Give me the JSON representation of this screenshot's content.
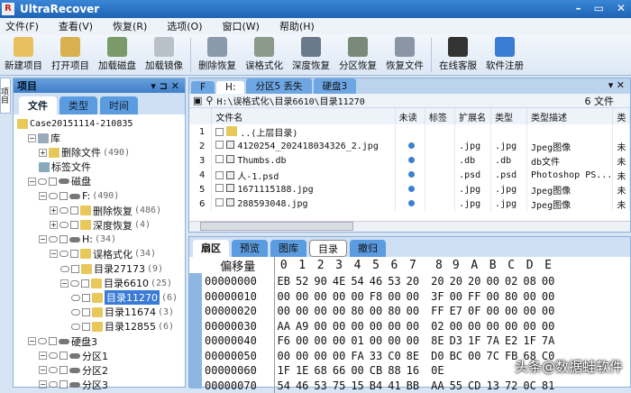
{
  "app": {
    "title": "UltraRecover",
    "logo": "R"
  },
  "menu": [
    "文件(F)",
    "查看(V)",
    "恢复(R)",
    "选项(O)",
    "窗口(W)",
    "帮助(H)"
  ],
  "toolbar": [
    {
      "label": "新建项目",
      "icon": "new-project-icon",
      "color": "#e8c060"
    },
    {
      "label": "打开项目",
      "icon": "open-project-icon",
      "color": "#d8b050"
    },
    {
      "label": "加载磁盘",
      "icon": "load-disk-icon",
      "color": "#7a9a6a"
    },
    {
      "label": "加载镜像",
      "icon": "load-image-icon",
      "color": "#b8c0c8"
    },
    {
      "label": "删除恢复",
      "icon": "delete-recover-icon",
      "color": "#8a9aaa"
    },
    {
      "label": "误格式化",
      "icon": "format-recover-icon",
      "color": "#8a9a8a"
    },
    {
      "label": "深度恢复",
      "icon": "deep-recover-icon",
      "color": "#6a7a8a"
    },
    {
      "label": "分区恢复",
      "icon": "partition-recover-icon",
      "color": "#7a8a7a"
    },
    {
      "label": "恢复文件",
      "icon": "save-file-icon",
      "color": "#8a96a6"
    },
    {
      "label": "在线客服",
      "icon": "qq-penguin-icon",
      "color": "#333333"
    },
    {
      "label": "软件注册",
      "icon": "dollar-icon",
      "color": "#3a7bd5"
    }
  ],
  "sidebar": {
    "tab": "项目"
  },
  "project": {
    "title": "项目",
    "tabs": [
      "文件",
      "类型",
      "时间"
    ],
    "tree": [
      {
        "label": "Case20151114-210835",
        "count": "",
        "level": 0,
        "type": "case"
      },
      {
        "label": "库",
        "count": "",
        "level": 1,
        "type": "lib"
      },
      {
        "label": "删除文件",
        "count": "(490)",
        "level": 2,
        "type": "folder"
      },
      {
        "label": "标签文件",
        "count": "",
        "level": 2,
        "type": "tag"
      },
      {
        "label": "磁盘",
        "count": "",
        "level": 1,
        "type": "disk"
      },
      {
        "label": "F:",
        "count": "(490)",
        "level": 2,
        "type": "disk"
      },
      {
        "label": "删除恢复",
        "count": "(486)",
        "level": 3,
        "type": "folder"
      },
      {
        "label": "深度恢复",
        "count": "(4)",
        "level": 3,
        "type": "folder"
      },
      {
        "label": "H:",
        "count": "(34)",
        "level": 2,
        "type": "disk"
      },
      {
        "label": "误格式化",
        "count": "(34)",
        "level": 3,
        "type": "folder"
      },
      {
        "label": "目录27173",
        "count": "(9)",
        "level": 4,
        "type": "folder"
      },
      {
        "label": "目录6610",
        "count": "(25)",
        "level": 4,
        "type": "folder"
      },
      {
        "label": "目录11270",
        "count": "(6)",
        "level": 5,
        "type": "folder",
        "selected": true
      },
      {
        "label": "目录11674",
        "count": "(3)",
        "level": 5,
        "type": "folder"
      },
      {
        "label": "目录12855",
        "count": "(6)",
        "level": 5,
        "type": "folder"
      },
      {
        "label": "硬盘3",
        "count": "",
        "level": 1,
        "type": "disk"
      },
      {
        "label": "分区1",
        "count": "",
        "level": 2,
        "type": "disk"
      },
      {
        "label": "分区2",
        "count": "",
        "level": 2,
        "type": "disk"
      },
      {
        "label": "分区3",
        "count": "",
        "level": 2,
        "type": "disk"
      }
    ]
  },
  "files": {
    "tabs": [
      "F",
      "H:",
      "分区5 丢失",
      "硬盘3"
    ],
    "path": "H:\\误格式化\\目录6610\\目录11270",
    "count": "6 文件",
    "columns": [
      "文件名",
      "未读",
      "标签",
      "扩展名",
      "类型",
      "类型描述",
      "类"
    ],
    "rows": [
      {
        "n": "1",
        "name": "..(上层目录)",
        "unread": false,
        "ext": "",
        "type": "",
        "desc": "",
        "extra": ""
      },
      {
        "n": "2",
        "name": "4120254_202418034326_2.jpg",
        "unread": true,
        "ext": ".jpg",
        "type": ".jpg",
        "desc": "Jpeg图像",
        "extra": "未"
      },
      {
        "n": "3",
        "name": "Thumbs.db",
        "unread": true,
        "ext": ".db",
        "type": ".db",
        "desc": "db文件",
        "extra": "未"
      },
      {
        "n": "4",
        "name": "人-1.psd",
        "unread": true,
        "ext": ".psd",
        "type": ".psd",
        "desc": "Photoshop PS...",
        "extra": "未"
      },
      {
        "n": "5",
        "name": "1671115188.jpg",
        "unread": true,
        "ext": ".jpg",
        "type": ".jpg",
        "desc": "Jpeg图像",
        "extra": "未"
      },
      {
        "n": "6",
        "name": "288593048.jpg",
        "unread": true,
        "ext": ".jpg",
        "type": ".jpg",
        "desc": "Jpeg图像",
        "extra": "未"
      }
    ]
  },
  "hex": {
    "tabs": [
      "扇区",
      "预览",
      "图库",
      "目录",
      "撤归"
    ],
    "offset_label": "偏移量",
    "cols": [
      "0",
      "1",
      "2",
      "3",
      "4",
      "5",
      "6",
      "7",
      "8",
      "9",
      "A",
      "B",
      "C",
      "D",
      "E"
    ],
    "rows": [
      {
        "off": "00000000",
        "b": [
          "EB",
          "52",
          "90",
          "4E",
          "54",
          "46",
          "53",
          "20",
          "20",
          "20",
          "20",
          "00",
          "02",
          "08",
          "00"
        ]
      },
      {
        "off": "00000010",
        "b": [
          "00",
          "00",
          "00",
          "00",
          "00",
          "F8",
          "00",
          "00",
          "3F",
          "00",
          "FF",
          "00",
          "80",
          "00",
          "00"
        ]
      },
      {
        "off": "00000020",
        "b": [
          "00",
          "00",
          "00",
          "00",
          "80",
          "00",
          "80",
          "00",
          "FF",
          "E7",
          "0F",
          "00",
          "00",
          "00",
          "00"
        ]
      },
      {
        "off": "00000030",
        "b": [
          "AA",
          "A9",
          "00",
          "00",
          "00",
          "00",
          "00",
          "00",
          "02",
          "00",
          "00",
          "00",
          "00",
          "00",
          "00"
        ]
      },
      {
        "off": "00000040",
        "b": [
          "F6",
          "00",
          "00",
          "00",
          "01",
          "00",
          "00",
          "00",
          "8E",
          "D3",
          "1F",
          "7A",
          "E2",
          "1F",
          "7A"
        ]
      },
      {
        "off": "00000050",
        "b": [
          "00",
          "00",
          "00",
          "00",
          "FA",
          "33",
          "C0",
          "8E",
          "D0",
          "BC",
          "00",
          "7C",
          "FB",
          "68",
          "C0"
        ]
      },
      {
        "off": "00000060",
        "b": [
          "1F",
          "1E",
          "68",
          "66",
          "00",
          "CB",
          "88",
          "16",
          "0E",
          "",
          "",
          "",
          "",
          "",
          ""
        ]
      },
      {
        "off": "00000070",
        "b": [
          "54",
          "46",
          "53",
          "75",
          "15",
          "B4",
          "41",
          "BB",
          "AA",
          "55",
          "CD",
          "13",
          "72",
          "0C",
          "81"
        ]
      }
    ]
  },
  "watermark": "头条@数据蛙软件"
}
